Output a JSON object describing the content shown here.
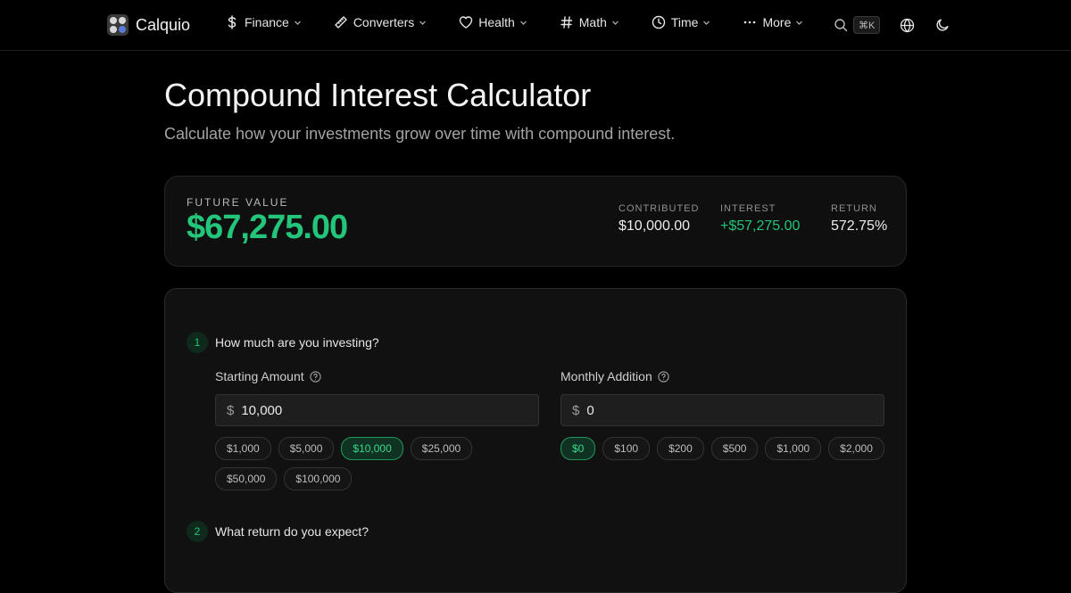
{
  "brand": {
    "name": "Calquio"
  },
  "nav": {
    "items": [
      {
        "label": "Finance",
        "icon": "dollar-icon"
      },
      {
        "label": "Converters",
        "icon": "ruler-icon"
      },
      {
        "label": "Health",
        "icon": "heart-icon"
      },
      {
        "label": "Math",
        "icon": "hash-icon"
      },
      {
        "label": "Time",
        "icon": "clock-icon"
      },
      {
        "label": "More",
        "icon": "dots-icon"
      }
    ],
    "search_shortcut": "⌘K"
  },
  "page": {
    "title": "Compound Interest Calculator",
    "subtitle": "Calculate how your investments grow over time with compound interest."
  },
  "summary": {
    "future_value_label": "FUTURE VALUE",
    "future_value": "$67,275.00",
    "contributed_label": "CONTRIBUTED",
    "contributed": "$10,000.00",
    "interest_label": "INTEREST",
    "interest": "+$57,275.00",
    "return_label": "RETURN",
    "return": "572.75%"
  },
  "steps": [
    {
      "number": "1",
      "text": "How much are you investing?"
    },
    {
      "number": "2",
      "text": "What return do you expect?"
    }
  ],
  "starting": {
    "label": "Starting Amount",
    "currency": "$",
    "value": "10,000",
    "chips": [
      "$1,000",
      "$5,000",
      "$10,000",
      "$25,000",
      "$50,000",
      "$100,000"
    ],
    "selected": "$10,000"
  },
  "monthly": {
    "label": "Monthly Addition",
    "currency": "$",
    "value": "0",
    "chips": [
      "$0",
      "$100",
      "$200",
      "$500",
      "$1,000",
      "$2,000"
    ],
    "selected": "$0"
  },
  "colors": {
    "accent": "#22c57a",
    "background": "#000000",
    "card": "#111111"
  }
}
